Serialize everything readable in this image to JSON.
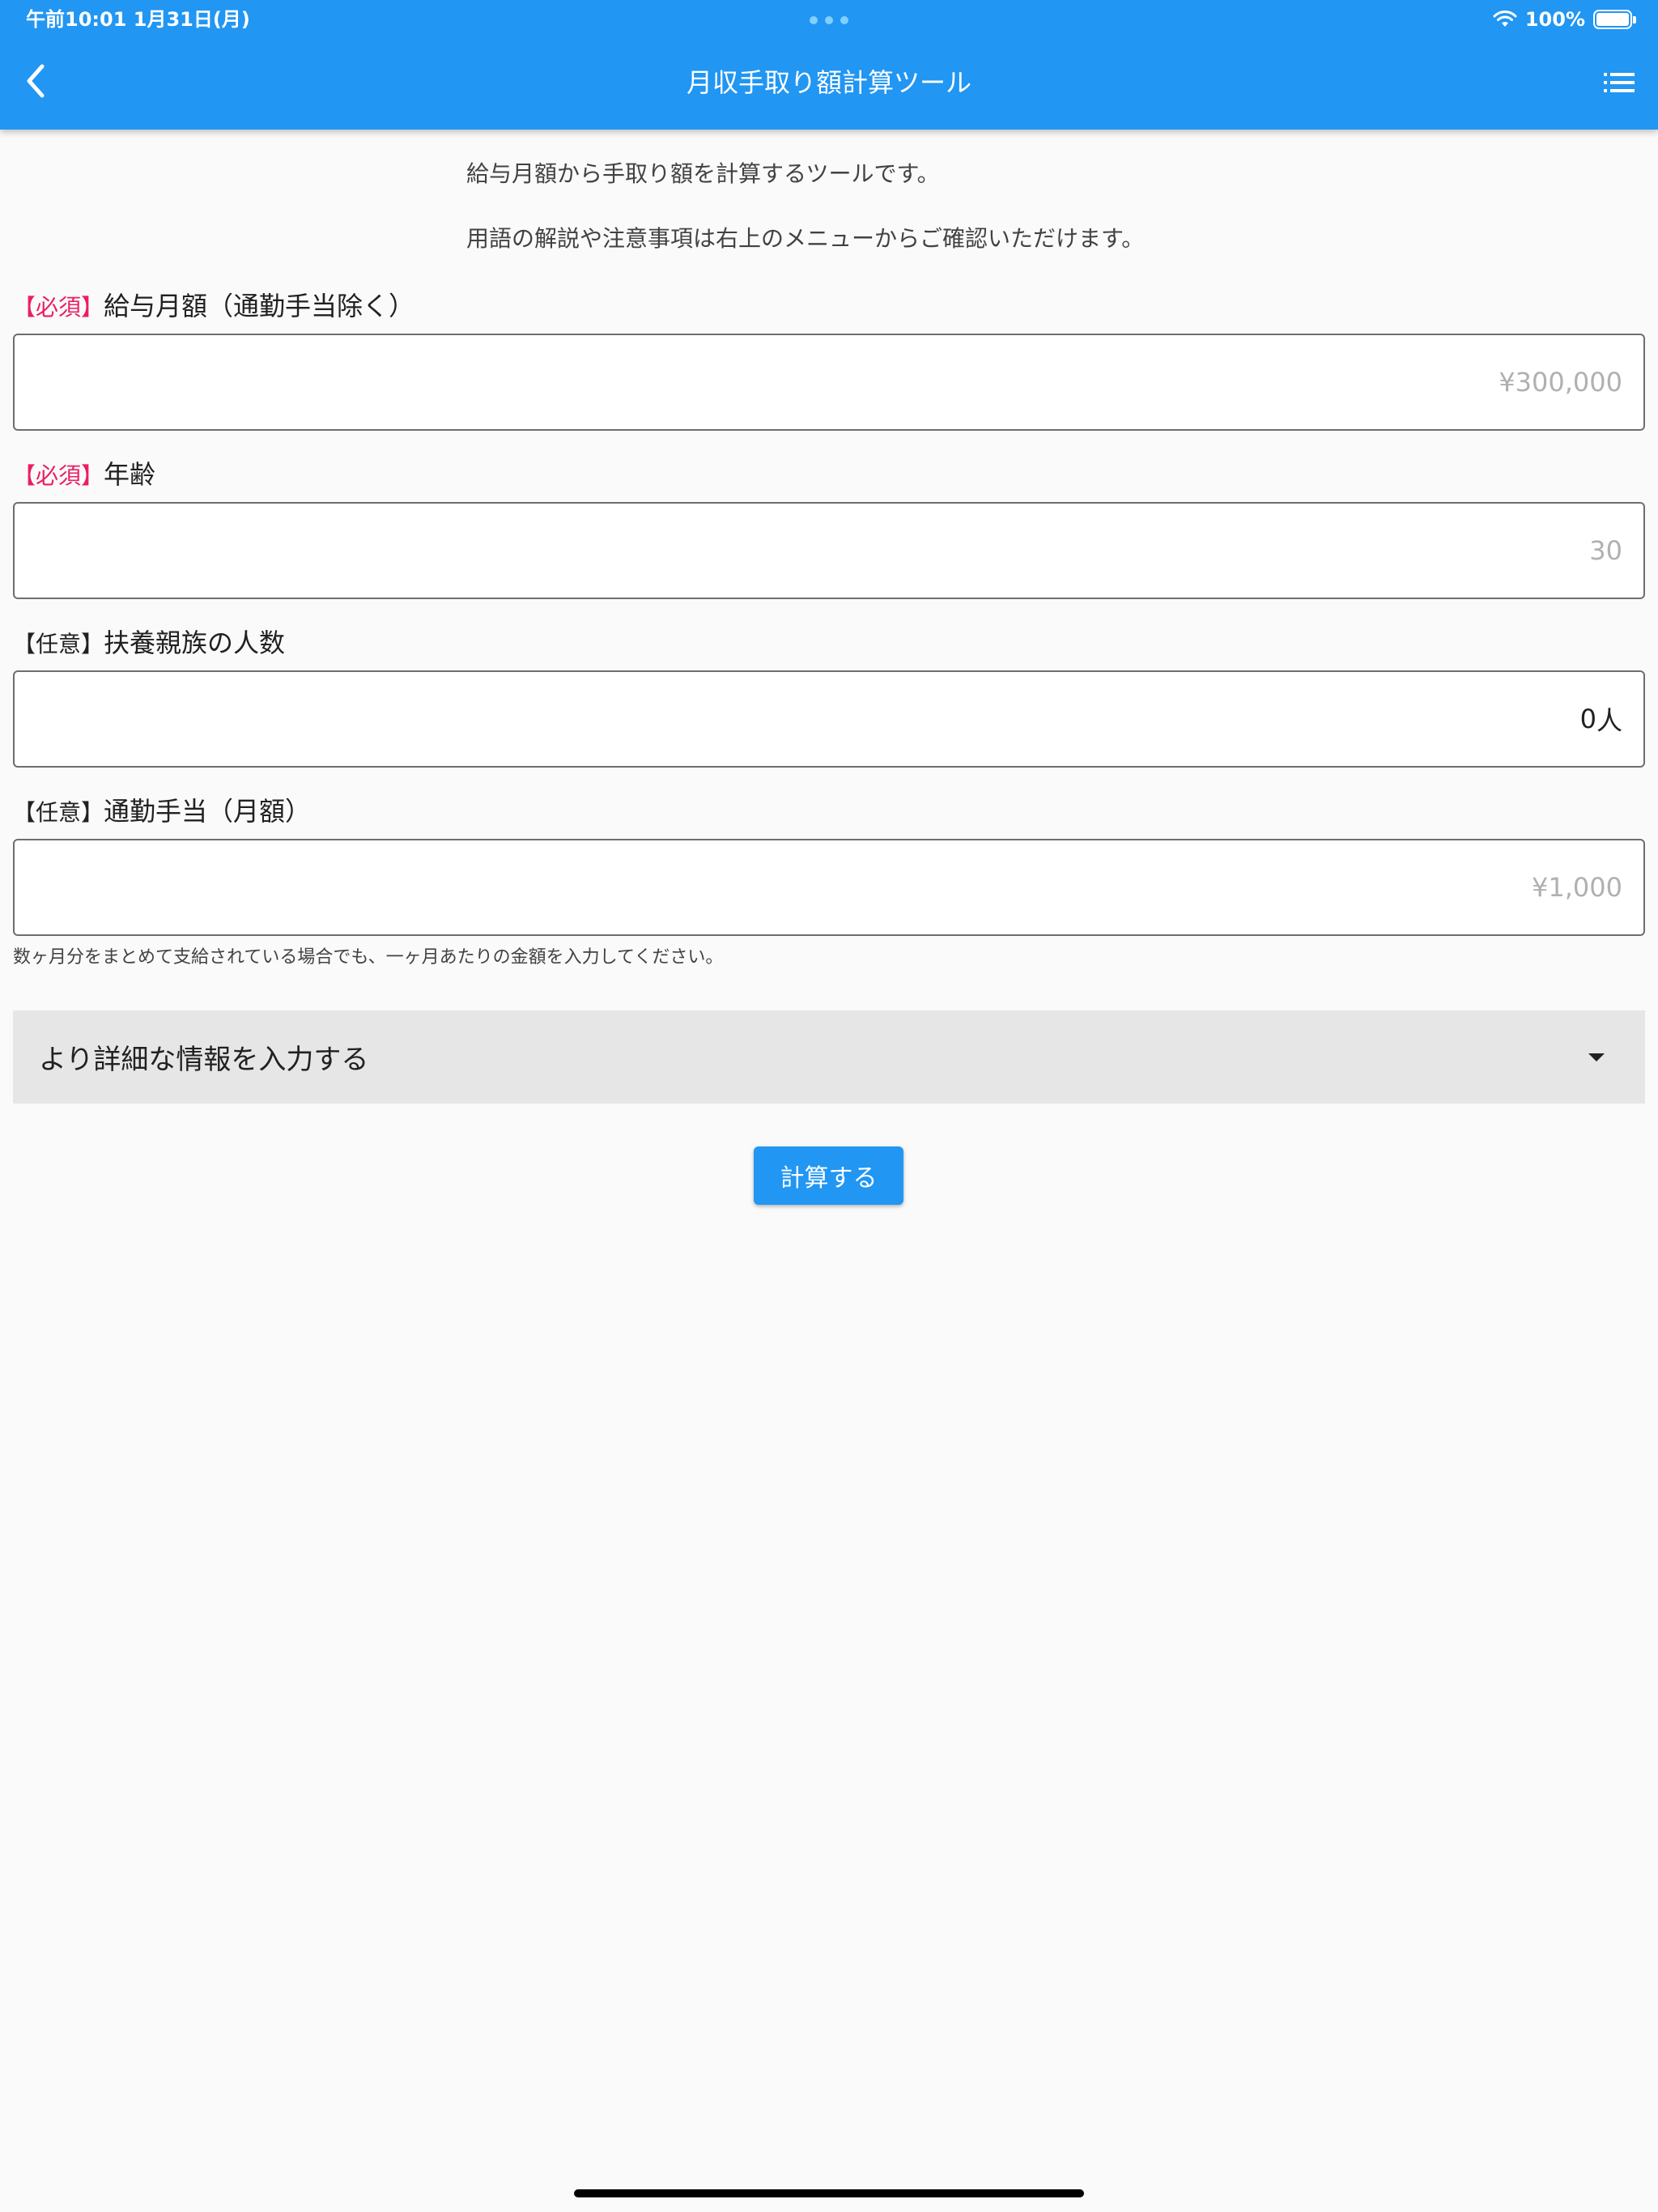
{
  "status_bar": {
    "time": "午前10:01   1月31日(月)",
    "battery_percent": "100%"
  },
  "header": {
    "title": "月収手取り額計算ツール",
    "back_icon": "chevron-left-icon",
    "menu_icon": "list-menu-icon"
  },
  "intro": {
    "line1": "給与月額から手取り額を計算するツールです。",
    "line2": "用語の解説や注意事項は右上のメニューからご確認いただけます。"
  },
  "form": {
    "salary": {
      "tag": "【必須】",
      "label": "給与月額（通勤手当除く）",
      "placeholder": "¥300,000",
      "value": ""
    },
    "age": {
      "tag": "【必須】",
      "label": "年齢",
      "placeholder": "30",
      "value": ""
    },
    "dependents": {
      "tag": "【任意】",
      "label": "扶養親族の人数",
      "value": "0",
      "suffix": "人"
    },
    "commute": {
      "tag": "【任意】",
      "label": "通勤手当（月額）",
      "placeholder": "¥1,000",
      "value": "",
      "helper": "数ヶ月分をまとめて支給されている場合でも、一ヶ月あたりの金額を入力してください。"
    }
  },
  "details_expander": {
    "label": "より詳細な情報を入力する"
  },
  "actions": {
    "calculate_label": "計算する"
  },
  "colors": {
    "primary": "#2196f3",
    "required_tag": "#e91e63",
    "background": "#fafafa"
  }
}
